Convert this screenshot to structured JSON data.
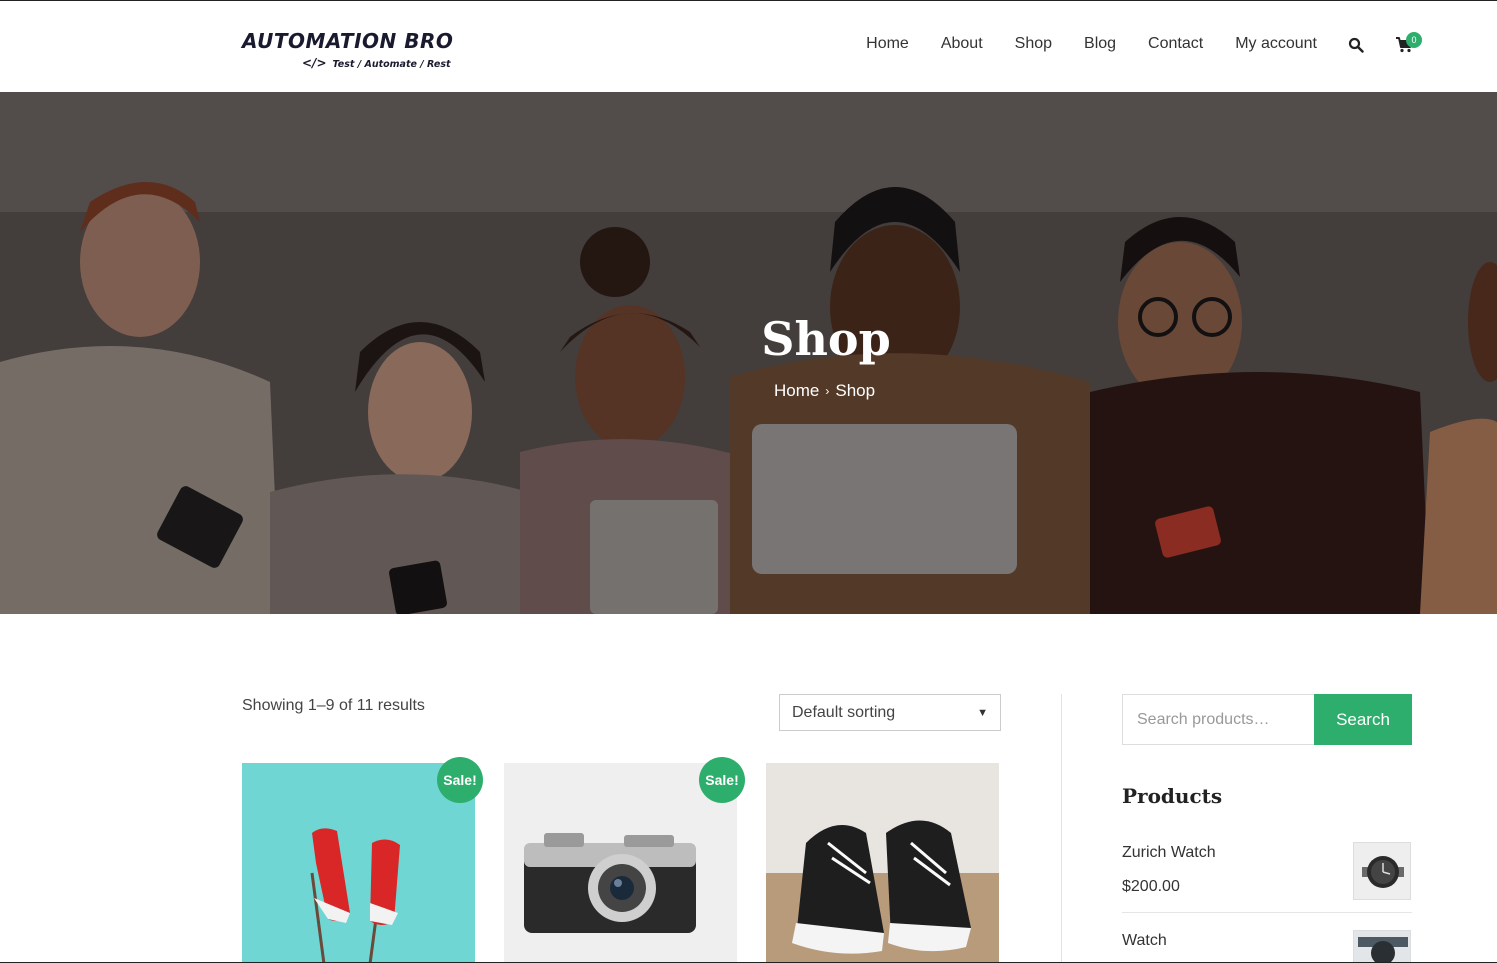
{
  "header": {
    "logo_title": "AUTOMATION BRO",
    "logo_code": "</>",
    "logo_tagline": "Test / Automate / Rest",
    "nav": [
      "Home",
      "About",
      "Shop",
      "Blog",
      "Contact",
      "My account"
    ],
    "cart_count": "0"
  },
  "hero": {
    "title": "Shop",
    "breadcrumb_home": "Home",
    "breadcrumb_sep": "›",
    "breadcrumb_current": "Shop"
  },
  "shop": {
    "result_count": "Showing 1–9 of 11 results",
    "sort_value": "Default sorting",
    "sale_label": "Sale!"
  },
  "sidebar": {
    "search_placeholder": "Search products…",
    "search_button": "Search",
    "widget_title": "Products",
    "items": [
      {
        "name": "Zurich Watch",
        "price": "$200.00"
      },
      {
        "name": "Watch"
      }
    ]
  },
  "colors": {
    "accent": "#2eae6c"
  }
}
